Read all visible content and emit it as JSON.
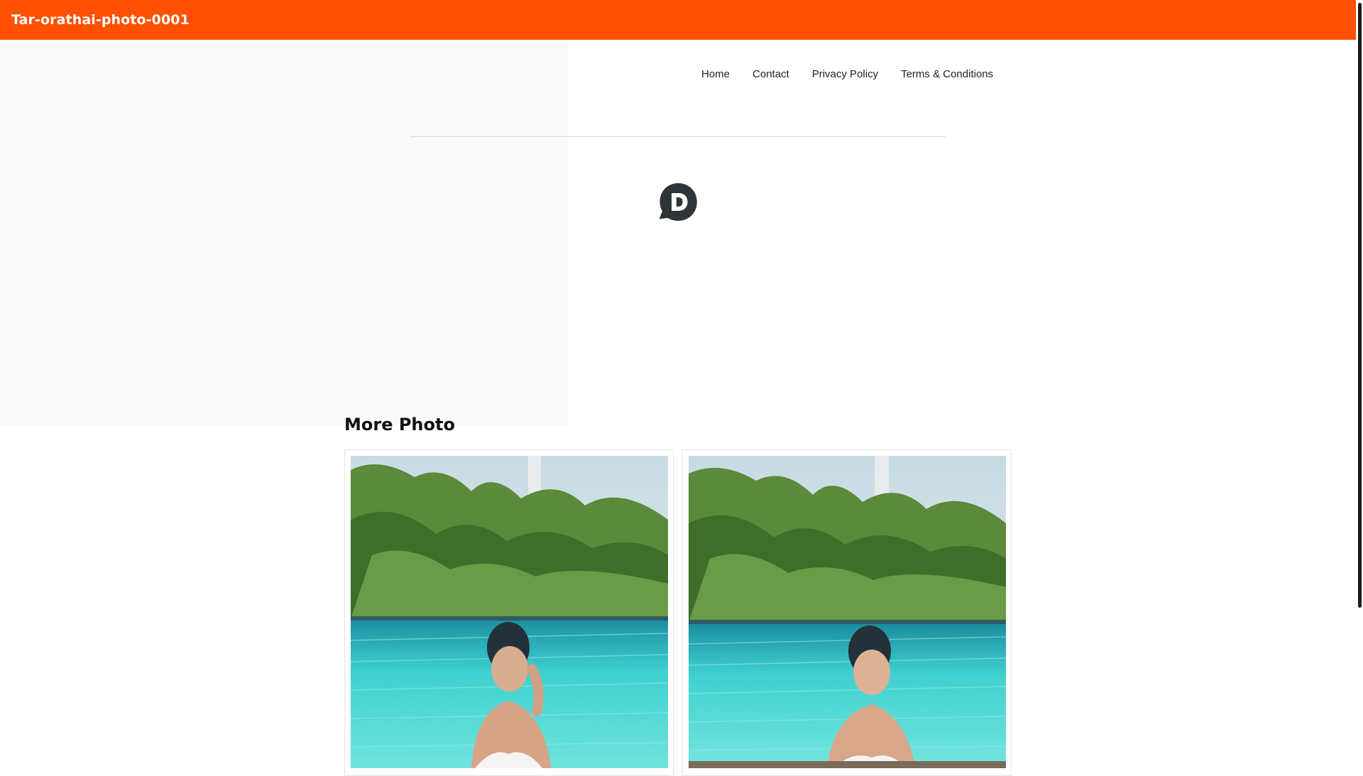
{
  "header": {
    "site_title": "Tar-orathai-photo-0001",
    "color": "#ff5003"
  },
  "nav": {
    "items": [
      "Home",
      "Contact",
      "Privacy Policy",
      "Terms & Conditions"
    ]
  },
  "comments": {
    "icon": "disqus-icon"
  },
  "more": {
    "title": "More Photo",
    "photos": [
      {
        "alt": "Photo 1",
        "icon": "photo-pool-1"
      },
      {
        "alt": "Photo 2",
        "icon": "photo-pool-2"
      }
    ]
  },
  "colors": {
    "accent": "#ff5003",
    "pool": "#3fd1d0",
    "foliage": "#5b8a3a"
  }
}
